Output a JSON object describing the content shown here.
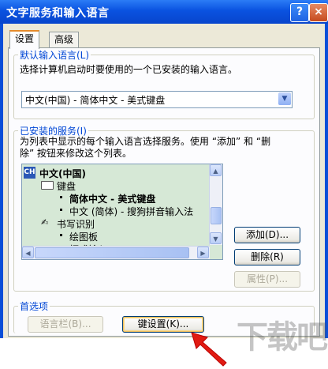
{
  "window": {
    "title": "文字服务和输入语言",
    "help_button": "?",
    "close_button": "×"
  },
  "tabs": [
    {
      "label": "设置"
    },
    {
      "label": "高级"
    }
  ],
  "default_language": {
    "group_label": "默认输入语言(L)",
    "description": "选择计算机启动时要使用的一个已安装的输入语言。",
    "selected_value": "中文(中国) - 简体中文 - 美式键盘"
  },
  "installed_services": {
    "group_label": "已安装的服务(I)",
    "description_line1": "为列表中显示的每个输入语言选择服务。使用 “添加” 和 “删",
    "description_line2": "除” 按钮来修改这个列表。",
    "tree": {
      "language": "中文(中国)",
      "language_badge": "CH",
      "keyboard_category": "键盘",
      "keyboard_items": [
        "简体中文 - 美式键盘",
        "中文 (简体) - 搜狗拼音输入法"
      ],
      "handwriting_category": "书写识别",
      "handwriting_items": [
        "绘图板",
        "框式输入"
      ]
    },
    "buttons": {
      "add": "添加(D)...",
      "remove": "删除(R)",
      "properties": "属性(P)..."
    }
  },
  "preferences": {
    "group_label": "首选项",
    "language_bar_button": "语言栏(B)...",
    "key_settings_button": "键设置(K)..."
  },
  "watermark_text": "下载吧"
}
